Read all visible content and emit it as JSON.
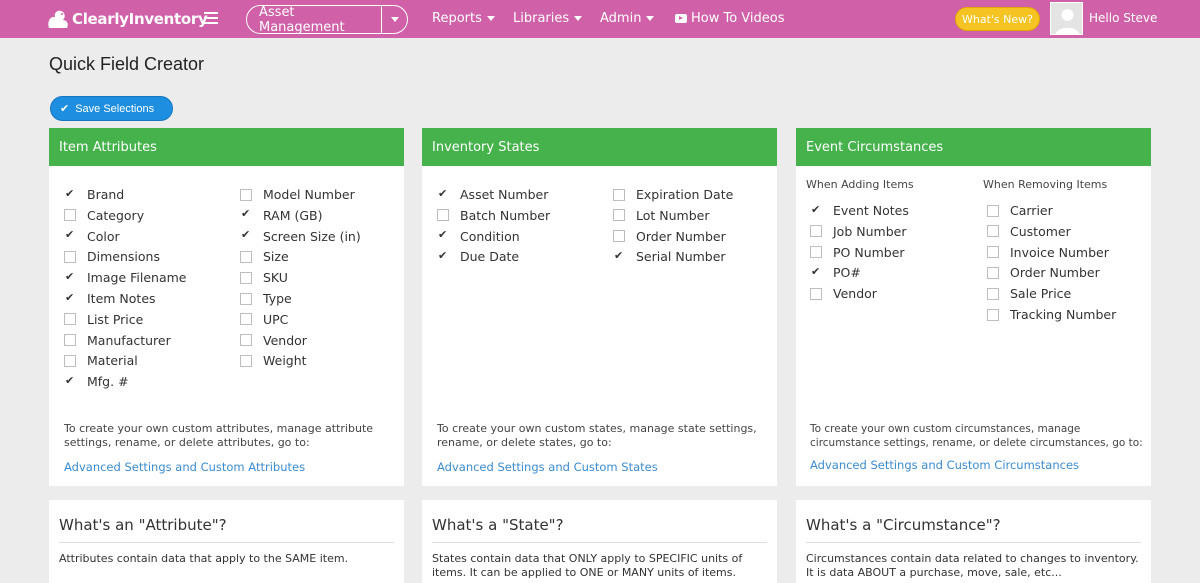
{
  "nav": {
    "logo_text": "ClearlyInventory",
    "module": "Asset Management",
    "items": [
      "Reports",
      "Libraries",
      "Admin"
    ],
    "videos": "How To Videos",
    "whats_new": "What's New?",
    "greeting": "Hello Steve"
  },
  "page": {
    "title": "Quick Field Creator",
    "save_label": "Save Selections"
  },
  "attributes": {
    "header": "Item Attributes",
    "col1": [
      {
        "label": "Brand",
        "checked": true
      },
      {
        "label": "Category",
        "checked": false
      },
      {
        "label": "Color",
        "checked": true
      },
      {
        "label": "Dimensions",
        "checked": false
      },
      {
        "label": "Image Filename",
        "checked": true
      },
      {
        "label": "Item Notes",
        "checked": true
      },
      {
        "label": "List Price",
        "checked": false
      },
      {
        "label": "Manufacturer",
        "checked": false
      },
      {
        "label": "Material",
        "checked": false
      },
      {
        "label": "Mfg. #",
        "checked": true
      }
    ],
    "col2": [
      {
        "label": "Model Number",
        "checked": false
      },
      {
        "label": "RAM (GB)",
        "checked": true
      },
      {
        "label": "Screen Size (in)",
        "checked": true
      },
      {
        "label": "Size",
        "checked": false
      },
      {
        "label": "SKU",
        "checked": false
      },
      {
        "label": "Type",
        "checked": false
      },
      {
        "label": "UPC",
        "checked": false
      },
      {
        "label": "Vendor",
        "checked": false
      },
      {
        "label": "Weight",
        "checked": false
      }
    ],
    "hint": "To create your own custom attributes, manage attribute settings, rename, or delete attributes, go to:",
    "link": "Advanced Settings and Custom Attributes"
  },
  "states": {
    "header": "Inventory States",
    "col1": [
      {
        "label": "Asset Number",
        "checked": true
      },
      {
        "label": "Batch Number",
        "checked": false
      },
      {
        "label": "Condition",
        "checked": true
      },
      {
        "label": "Due Date",
        "checked": true
      }
    ],
    "col2": [
      {
        "label": "Expiration Date",
        "checked": false
      },
      {
        "label": "Lot Number",
        "checked": false
      },
      {
        "label": "Order Number",
        "checked": false
      },
      {
        "label": "Serial Number",
        "checked": true
      }
    ],
    "hint": "To create your own custom states, manage state settings, rename, or delete states, go to:",
    "link": "Advanced Settings and Custom States"
  },
  "circumstances": {
    "header": "Event Circumstances",
    "adding_label": "When Adding Items",
    "removing_label": "When Removing Items",
    "col1": [
      {
        "label": "Event Notes",
        "checked": true
      },
      {
        "label": "Job Number",
        "checked": false
      },
      {
        "label": "PO Number",
        "checked": false
      },
      {
        "label": "PO#",
        "checked": true
      },
      {
        "label": "Vendor",
        "checked": false
      }
    ],
    "col2": [
      {
        "label": "Carrier",
        "checked": false
      },
      {
        "label": "Customer",
        "checked": false
      },
      {
        "label": "Invoice Number",
        "checked": false
      },
      {
        "label": "Order Number",
        "checked": false
      },
      {
        "label": "Sale Price",
        "checked": false
      },
      {
        "label": "Tracking Number",
        "checked": false
      }
    ],
    "hint": "To create your own custom circumstances, manage circumstance settings, rename, or delete circumstances, go to:",
    "link": "Advanced Settings and Custom Circumstances"
  },
  "info": [
    {
      "title": "What's an \"Attribute\"?",
      "text": "Attributes contain data that apply to the SAME item."
    },
    {
      "title": "What's a \"State\"?",
      "text": "States contain data that ONLY apply to SPECIFIC units of items. It can be applied to ONE or MANY units of items."
    },
    {
      "title": "What's a \"Circumstance\"?",
      "text": "Circumstances contain data related to changes to inventory. It is data ABOUT a purchase, move, sale, etc..."
    }
  ],
  "colors": {
    "topbar": "#d060a8",
    "panel_header": "#45b24b",
    "save_button": "#1e8fe0",
    "whats_new": "#f5c322",
    "link": "#3b8bd0"
  }
}
